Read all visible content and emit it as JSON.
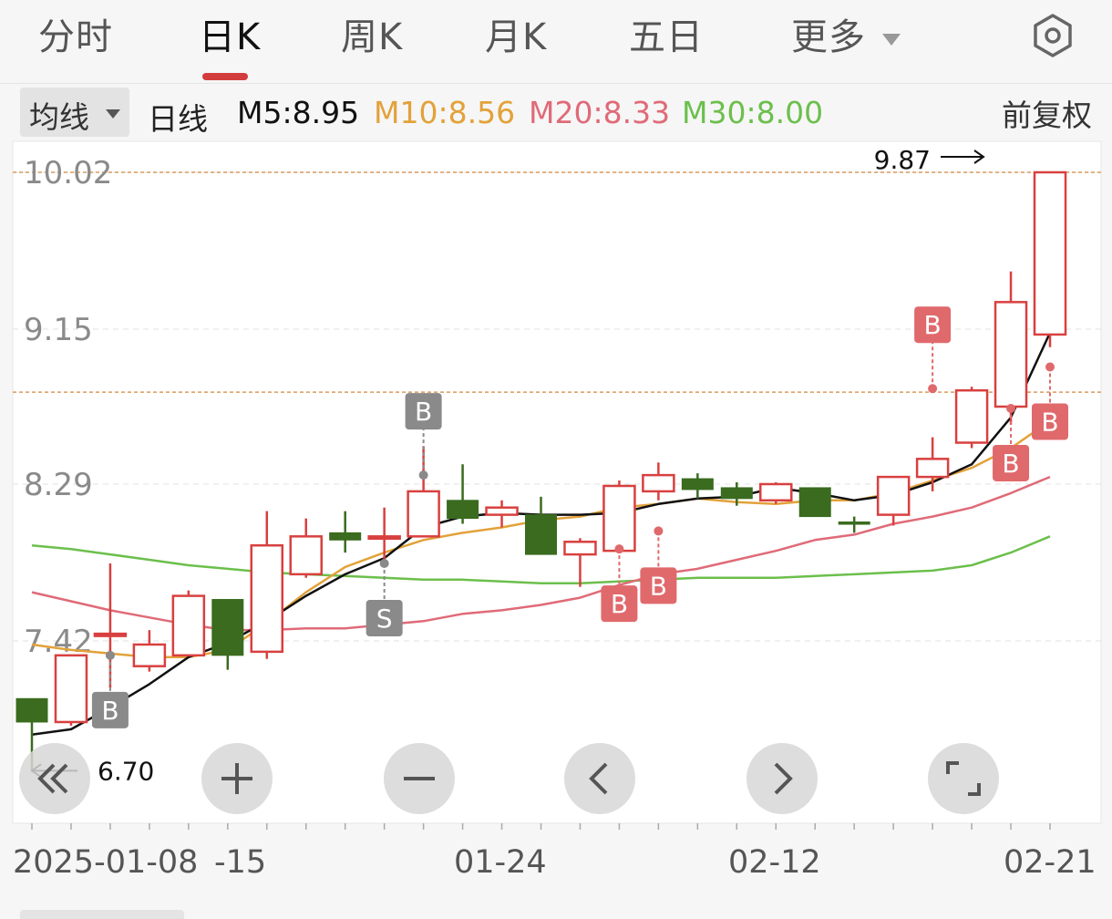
{
  "tabs": [
    {
      "label": "分时"
    },
    {
      "label": "日K"
    },
    {
      "label": "周K"
    },
    {
      "label": "月K"
    },
    {
      "label": "五日"
    },
    {
      "label": "更多"
    }
  ],
  "ma_bar": {
    "selector_label": "均线",
    "period_label": "日线",
    "items": [
      {
        "label": "M5:8.95",
        "color": "#111111"
      },
      {
        "label": "M10:8.56",
        "color": "#e2a23a"
      },
      {
        "label": "M20:8.33",
        "color": "#e06a78"
      },
      {
        "label": "M30:8.00",
        "color": "#6cbf4c"
      }
    ],
    "adjust_label": "前复权"
  },
  "controls": [
    {
      "icon": "double-left-icon"
    },
    {
      "icon": "zoom-in-icon"
    },
    {
      "icon": "zoom-out-icon"
    },
    {
      "icon": "chevron-left-icon"
    },
    {
      "icon": "chevron-right-icon"
    },
    {
      "icon": "fullscreen-icon"
    }
  ],
  "colors": {
    "up": "#d8403f",
    "down": "#3a6b1f",
    "marker_buy": "#e0696c",
    "marker_gray": "#8a8a8a"
  },
  "chart_data": {
    "type": "candlestick",
    "price_ticks": [
      "10.02",
      "9.15",
      "8.29",
      "7.42"
    ],
    "ylim": [
      6.5,
      10.15
    ],
    "ref_lines": [
      10.02,
      8.8
    ],
    "max_label": "9.87",
    "min_label": "6.70",
    "x_labels": [
      "2025-01-08",
      "-15",
      "01-24",
      "02-12",
      "02-21"
    ],
    "candles": [
      {
        "o": 7.1,
        "c": 6.97,
        "h": 7.1,
        "l": 6.7
      },
      {
        "o": 6.97,
        "c": 7.34,
        "h": 7.34,
        "l": 6.95
      },
      {
        "o": 7.46,
        "c": 7.46,
        "h": 7.85,
        "l": 7.16
      },
      {
        "o": 7.28,
        "c": 7.4,
        "h": 7.48,
        "l": 7.25
      },
      {
        "o": 7.34,
        "c": 7.67,
        "h": 7.7,
        "l": 7.34
      },
      {
        "o": 7.65,
        "c": 7.34,
        "h": 7.65,
        "l": 7.26
      },
      {
        "o": 7.36,
        "c": 7.95,
        "h": 8.14,
        "l": 7.32
      },
      {
        "o": 7.79,
        "c": 8.0,
        "h": 8.1,
        "l": 7.77
      },
      {
        "o": 8.02,
        "c": 7.98,
        "h": 8.14,
        "l": 7.91
      },
      {
        "o": 8.0,
        "c": 8.0,
        "h": 8.16,
        "l": 7.85
      },
      {
        "o": 8.0,
        "c": 8.25,
        "h": 8.5,
        "l": 8.0
      },
      {
        "o": 8.2,
        "c": 8.1,
        "h": 8.4,
        "l": 8.07
      },
      {
        "o": 8.12,
        "c": 8.16,
        "h": 8.2,
        "l": 8.05
      },
      {
        "o": 8.12,
        "c": 7.9,
        "h": 8.22,
        "l": 7.9
      },
      {
        "o": 7.9,
        "c": 7.97,
        "h": 7.99,
        "l": 7.72
      },
      {
        "o": 7.92,
        "c": 8.28,
        "h": 8.31,
        "l": 7.92
      },
      {
        "o": 8.25,
        "c": 8.34,
        "h": 8.41,
        "l": 8.2
      },
      {
        "o": 8.32,
        "c": 8.26,
        "h": 8.35,
        "l": 8.21
      },
      {
        "o": 8.27,
        "c": 8.21,
        "h": 8.3,
        "l": 8.17
      },
      {
        "o": 8.2,
        "c": 8.29,
        "h": 8.3,
        "l": 8.18
      },
      {
        "o": 8.27,
        "c": 8.11,
        "h": 8.27,
        "l": 8.11
      },
      {
        "o": 8.08,
        "c": 8.07,
        "h": 8.11,
        "l": 8.02
      },
      {
        "o": 8.12,
        "c": 8.33,
        "h": 8.33,
        "l": 8.06
      },
      {
        "o": 8.33,
        "c": 8.43,
        "h": 8.55,
        "l": 8.25
      },
      {
        "o": 8.52,
        "c": 8.81,
        "h": 8.83,
        "l": 8.49
      },
      {
        "o": 8.72,
        "c": 9.3,
        "h": 9.47,
        "l": 8.62
      },
      {
        "o": 9.12,
        "c": 10.02,
        "h": 10.02,
        "l": 9.05
      }
    ],
    "series": [
      {
        "name": "M5",
        "values": [
          6.9,
          6.93,
          7.05,
          7.18,
          7.33,
          7.41,
          7.53,
          7.67,
          7.79,
          7.88,
          8.05,
          8.11,
          8.13,
          8.12,
          8.12,
          8.13,
          8.18,
          8.21,
          8.22,
          8.27,
          8.24,
          8.2,
          8.23,
          8.3,
          8.4,
          8.66,
          9.13
        ]
      },
      {
        "name": "M10",
        "values": [
          7.4,
          7.37,
          7.35,
          7.33,
          7.33,
          7.37,
          7.52,
          7.69,
          7.83,
          7.91,
          7.98,
          8.02,
          8.05,
          8.09,
          8.11,
          8.16,
          8.18,
          8.21,
          8.19,
          8.18,
          8.2,
          8.2,
          8.24,
          8.31,
          8.38,
          8.49,
          8.64
        ]
      },
      {
        "name": "M20",
        "values": [
          7.69,
          7.64,
          7.59,
          7.55,
          7.51,
          7.48,
          7.48,
          7.49,
          7.49,
          7.51,
          7.53,
          7.57,
          7.59,
          7.62,
          7.66,
          7.73,
          7.79,
          7.82,
          7.87,
          7.92,
          7.98,
          8.01,
          8.07,
          8.11,
          8.16,
          8.24,
          8.33
        ]
      },
      {
        "name": "M30",
        "values": [
          7.95,
          7.93,
          7.9,
          7.87,
          7.84,
          7.82,
          7.8,
          7.79,
          7.78,
          7.77,
          7.76,
          7.76,
          7.75,
          7.74,
          7.74,
          7.75,
          7.76,
          7.77,
          7.77,
          7.77,
          7.78,
          7.79,
          7.8,
          7.81,
          7.84,
          7.91,
          8.0
        ]
      }
    ],
    "markers": [
      {
        "i": 2,
        "label": "B",
        "kind": "gray",
        "dir": "down",
        "price": 7.34
      },
      {
        "i": 9,
        "label": "S",
        "kind": "gray",
        "dir": "down",
        "price": 7.85
      },
      {
        "i": 10,
        "label": "B",
        "kind": "gray",
        "dir": "up",
        "price": 8.34
      },
      {
        "i": 15,
        "label": "B",
        "kind": "buy",
        "dir": "down",
        "price": 7.93
      },
      {
        "i": 16,
        "label": "B",
        "kind": "buy",
        "dir": "down",
        "price": 8.03
      },
      {
        "i": 23,
        "label": "B",
        "kind": "buy",
        "dir": "up",
        "price": 8.82
      },
      {
        "i": 25,
        "label": "B",
        "kind": "buy",
        "dir": "down",
        "price": 8.71
      },
      {
        "i": 26,
        "label": "B",
        "kind": "buy",
        "dir": "down",
        "price": 8.94
      }
    ]
  }
}
